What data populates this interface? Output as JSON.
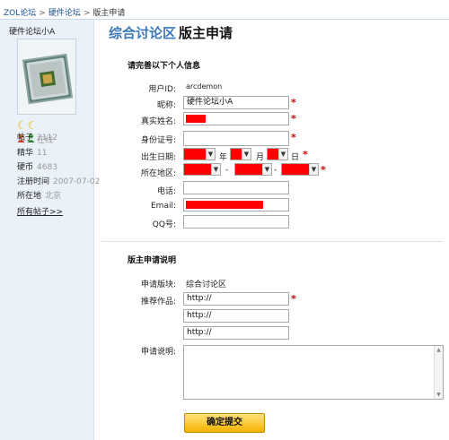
{
  "breadcrumb": {
    "items": [
      "ZOL论坛",
      "硬件论坛",
      "版主申请"
    ],
    "separator": ">"
  },
  "sidebar": {
    "username": "硬件论坛小A",
    "rank_icons": "☾☾",
    "online_text": "在线",
    "stats": [
      {
        "label": "帖子",
        "value": "2112"
      },
      {
        "label": "精华",
        "value": "11"
      },
      {
        "label": "硬币",
        "value": "4683"
      },
      {
        "label": "注册时间",
        "value": "2007-07-02"
      },
      {
        "label": "所在地",
        "value": "北京"
      }
    ],
    "all_posts_link": "所有帖子>>"
  },
  "header": {
    "forum_name": "综合讨论区",
    "subtitle": "版主申请"
  },
  "personal_section": {
    "heading": "请完善以下个人信息",
    "user_id_label": "用户ID:",
    "user_id_value": "arcdemon",
    "nickname_label": "昵称:",
    "nickname_value": "硬件论坛小A",
    "realname_label": "真实姓名:",
    "idcard_label": "身份证号:",
    "birth_label": "出生日期:",
    "year_unit": "年",
    "month_unit": "月",
    "day_unit": "日",
    "region_label": "所在地区:",
    "region_sep": "-",
    "phone_label": "电话:",
    "email_label": "Email:",
    "qq_label": "QQ号:",
    "required_mark": "*"
  },
  "apply_section": {
    "heading": "版主申请说明",
    "board_label": "申请版块:",
    "board_value": "综合讨论区",
    "works_label": "推荐作品:",
    "works_values": [
      "http://",
      "http://",
      "http://"
    ],
    "desc_label": "申请说明:"
  },
  "submit_label": "确定提交",
  "colors": {
    "accent_blue": "#3a78b8",
    "redacted": "#ff0000",
    "required": "#d40000",
    "sidebar_bg": "#eaf1f8",
    "button": "#f4b300"
  }
}
